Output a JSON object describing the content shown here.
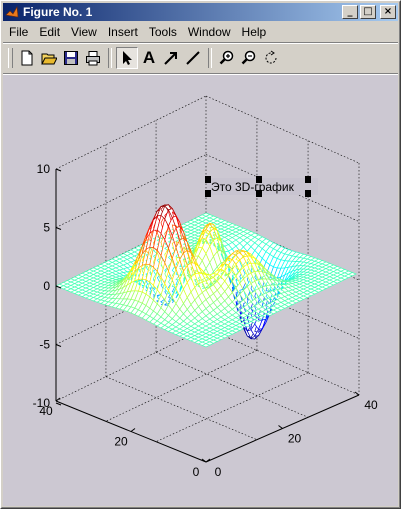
{
  "window": {
    "title": "Figure No. 1",
    "controls": {
      "minimize": "_",
      "maximize": "□",
      "close": "×"
    }
  },
  "menu": [
    {
      "label": "File"
    },
    {
      "label": "Edit"
    },
    {
      "label": "View"
    },
    {
      "label": "Insert"
    },
    {
      "label": "Tools"
    },
    {
      "label": "Window"
    },
    {
      "label": "Help"
    }
  ],
  "toolbar": {
    "items": [
      "new-icon",
      "open-icon",
      "save-icon",
      "print-icon",
      "arrow-select-icon",
      "text-icon",
      "arrow-icon",
      "line-icon",
      "zoom-in-icon",
      "zoom-out-icon",
      "rotate-icon"
    ],
    "text_tool_label": "A"
  },
  "plot": {
    "annotation": "Это 3D-график",
    "z_ticks": [
      "10",
      "5",
      "0",
      "-5",
      "-10"
    ],
    "x_ticks": [
      "40",
      "20",
      "0"
    ],
    "y_ticks": [
      "0",
      "20",
      "40"
    ],
    "colormap": "jet",
    "grid": true,
    "background": "#ccc8d2"
  }
}
